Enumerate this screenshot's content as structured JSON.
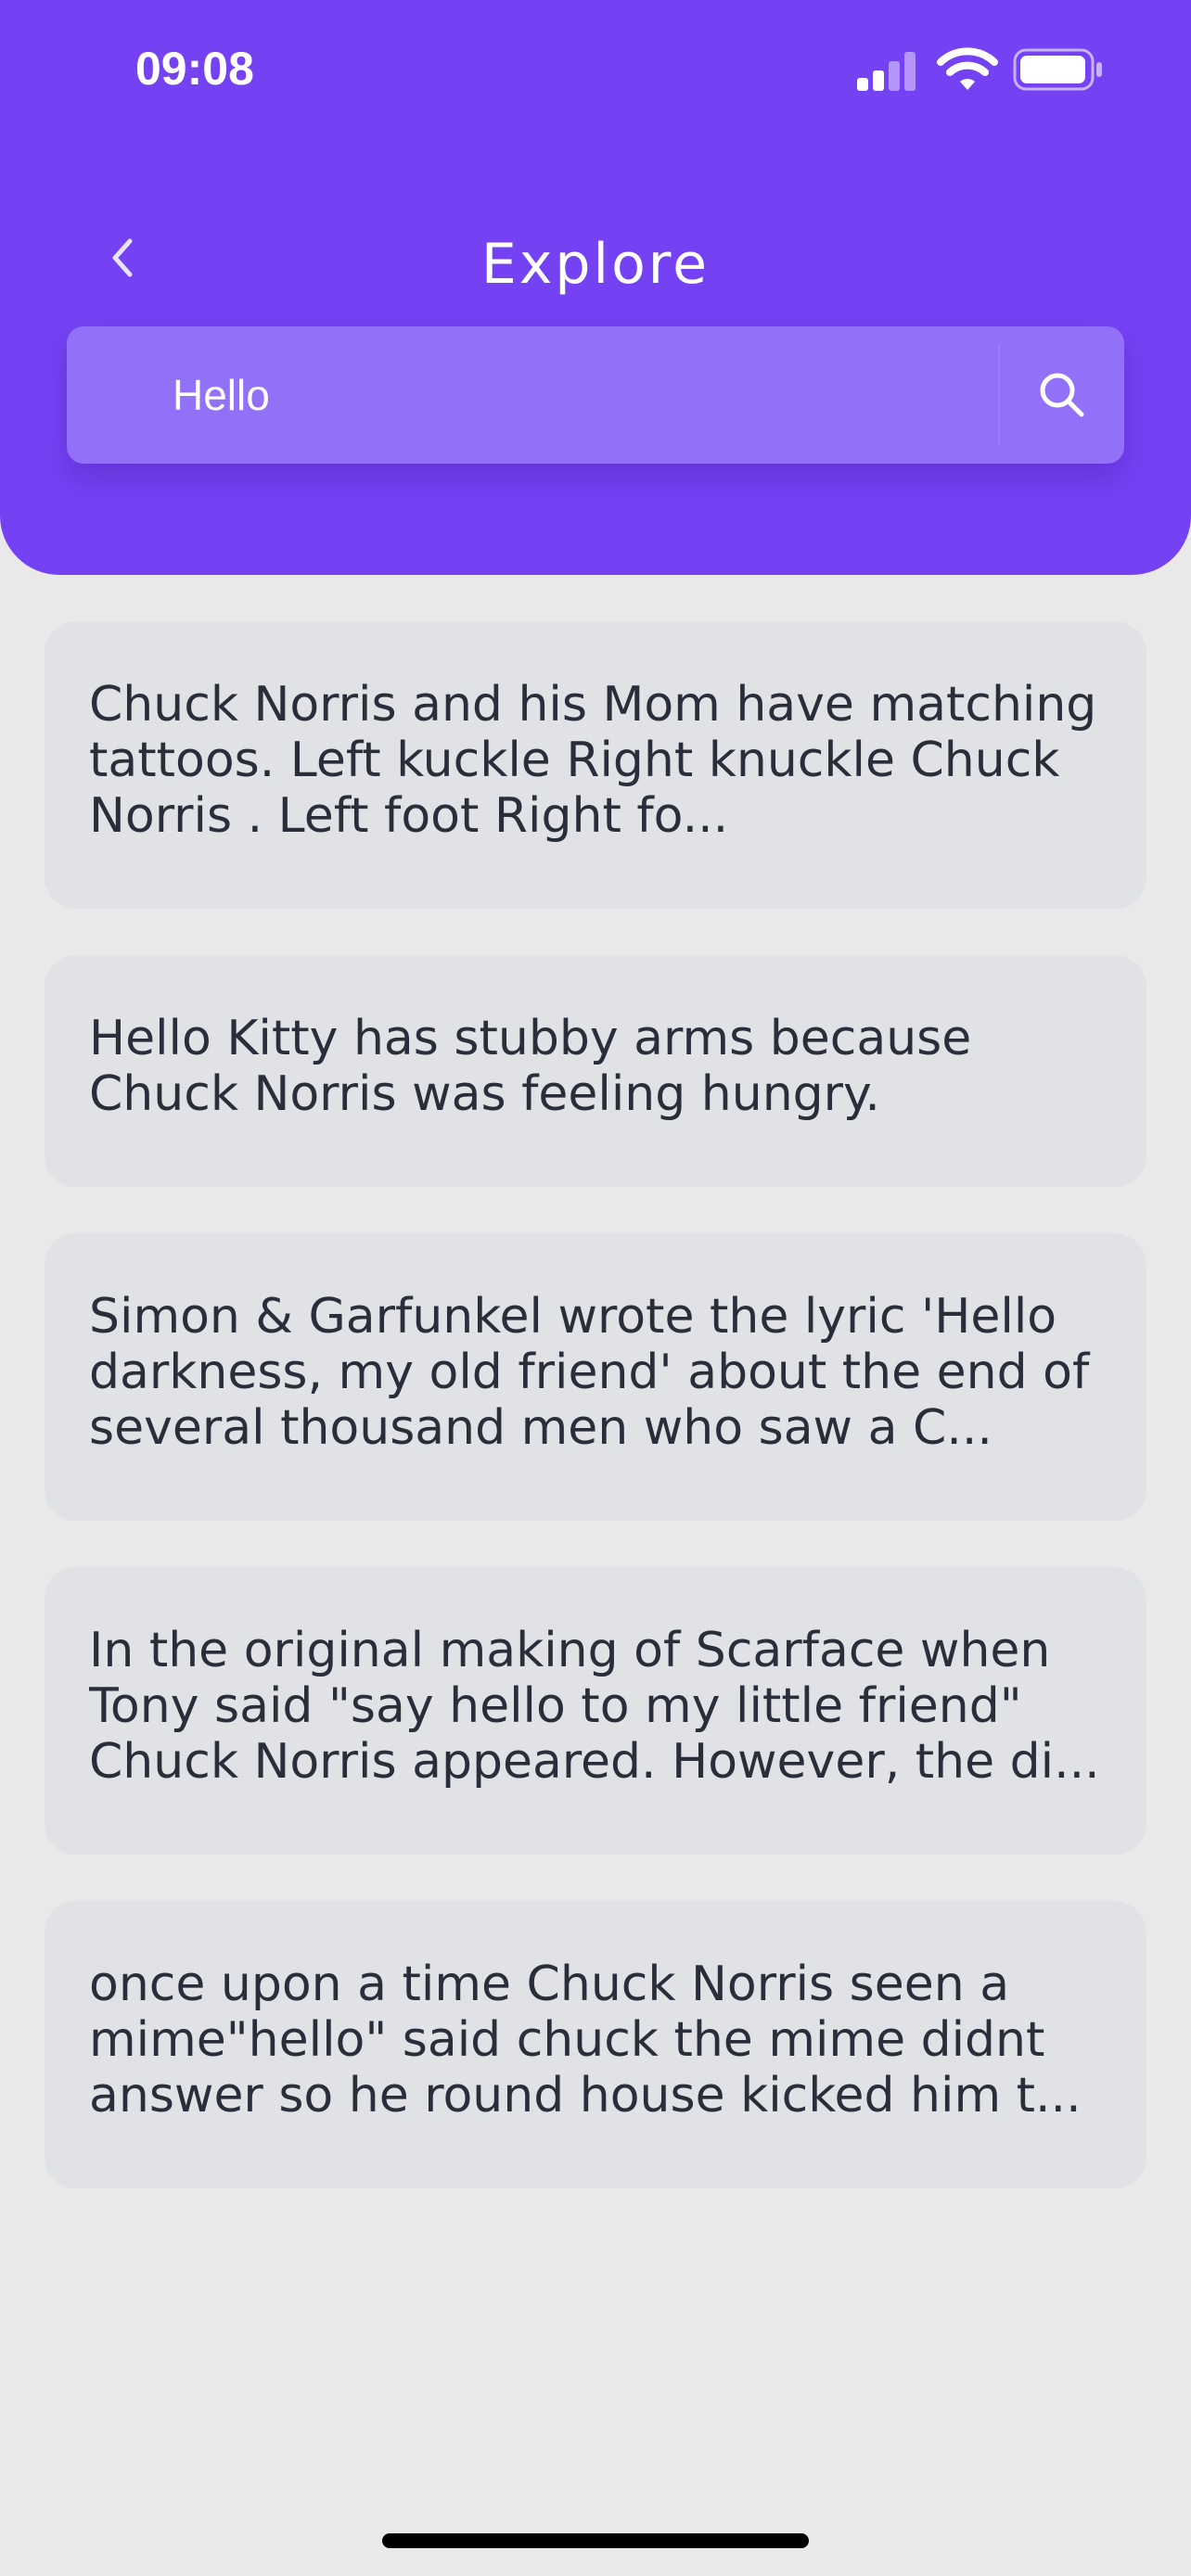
{
  "status_bar": {
    "time": "09:08",
    "signal_icon": "cellular-signal-icon",
    "wifi_icon": "wifi-icon",
    "battery_icon": "battery-icon"
  },
  "header": {
    "title": "Explore",
    "back_icon": "chevron-left-icon",
    "background_color": "#7442f3"
  },
  "search": {
    "value": "Hello",
    "placeholder": "",
    "icon": "search-icon",
    "background_color": "#9270f8"
  },
  "results": [
    {
      "text": "Chuck Norris and his Mom have matching tattoos. Left kuckle Right knuckle Chuck Norris . Left foot Right fo..."
    },
    {
      "text": "Hello Kitty has stubby arms because Chuck Norris was feeling hungry."
    },
    {
      "text": "Simon & Garfunkel wrote the lyric 'Hello darkness, my old friend' about the end of several thousand men who saw a C..."
    },
    {
      "text": "In the original making of Scarface when Tony said \"say hello to my little friend\" Chuck Norris appeared. However, the di..."
    },
    {
      "text": "once upon a time Chuck Norris seen a mime\"hello\" said chuck the mime didnt answer so he round house kicked him t..."
    }
  ],
  "colors": {
    "page_background": "#e9e9ea",
    "card_background": "#e1e2e5",
    "card_text": "#2a2d3a"
  }
}
